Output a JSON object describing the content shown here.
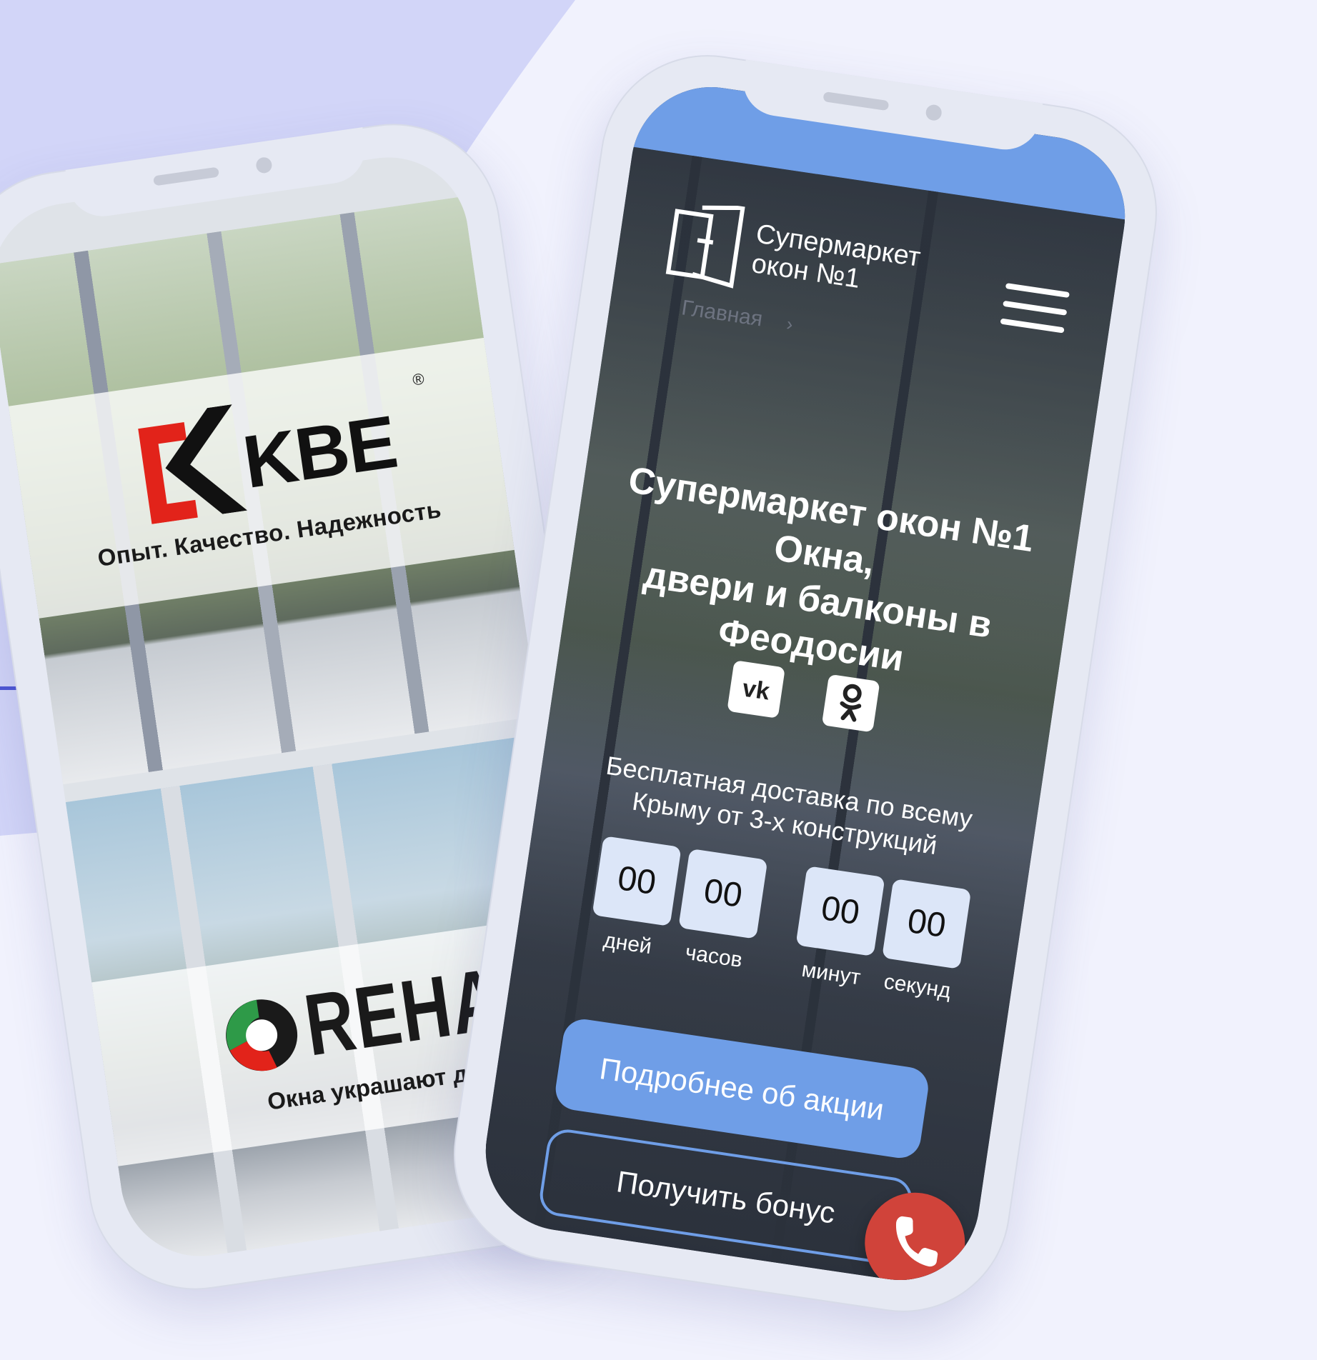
{
  "colors": {
    "background": "#f1f2fd",
    "blob": "#d2d5f8",
    "accent": "#4d56d4",
    "button_blue": "#6f9ee7",
    "countdown_box": "#dce6f8",
    "call_red": "#d0433a",
    "kbe_red": "#e2231a"
  },
  "left_phone": {
    "kbe": {
      "brand": "KBE",
      "registered": "®",
      "slogan": "Опыт. Качество. Надежность"
    },
    "rehau": {
      "brand": "REHAU",
      "slogan": "Окна украшают дом"
    }
  },
  "right_phone": {
    "header": {
      "logo_line1": "Супермаркет",
      "logo_line2": "окон №1",
      "menu_icon": "burger-menu-icon"
    },
    "breadcrumb": {
      "home": "Главная",
      "separator": "›"
    },
    "hero": {
      "title_line1": "Супермаркет окон №1 Окна,",
      "title_line2": "двери и балконы в",
      "title_line3": "Феодосии"
    },
    "socials": [
      {
        "name": "vk",
        "icon": "vk-icon"
      },
      {
        "name": "ok",
        "icon": "odnoklassniki-icon"
      }
    ],
    "promo": {
      "line1": "Бесплатная доставка по всему",
      "line2": "Крыму от 3-х конструкций"
    },
    "countdown": [
      {
        "value": "00",
        "label": "дней"
      },
      {
        "value": "00",
        "label": "часов"
      },
      {
        "value": "00",
        "label": "минут"
      },
      {
        "value": "00",
        "label": "секунд"
      }
    ],
    "buttons": {
      "primary": "Подробнее об акции",
      "secondary": "Получить бонус"
    },
    "call_icon": "phone-icon"
  }
}
